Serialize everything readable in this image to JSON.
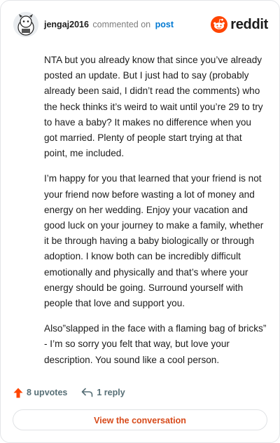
{
  "comment": {
    "author": "jengaj2016",
    "action_text": "commented on",
    "post_link": "post",
    "paragraphs": [
      "NTA but you already know that since you’ve already posted an update. But I just had to say (probably already been said, I didn’t read the comments) who the heck thinks it’s weird to wait until you’re 29 to try to have a baby? It makes no difference when you got married. Plenty of people start trying at that point, me included.",
      "I’m happy for you that learned that your friend is not your friend now before wasting a lot of money and energy on her wedding. Enjoy your vacation and good luck on your journey to make a family, whether it be through having a baby biologically or through adoption. I know both can be incredibly difficult emotionally and physically and that’s where your energy should be going. Surround yourself with people that love and support you.",
      "Also”slapped in the face with a flaming bag of bricks” - I’m so sorry you felt that way, but love your description. You sound like a cool person."
    ]
  },
  "brand": {
    "wordmark": "reddit",
    "color": "#ff4500"
  },
  "actions": {
    "upvotes_label": "8 upvotes",
    "reply_label": "1 reply"
  },
  "footer": {
    "view_conversation_label": "View the conversation"
  },
  "colors": {
    "text": "#1c1c1c",
    "muted": "#7c7c7c",
    "link": "#0079d3",
    "upvote": "#ff4500",
    "cta": "#d74a1a"
  }
}
